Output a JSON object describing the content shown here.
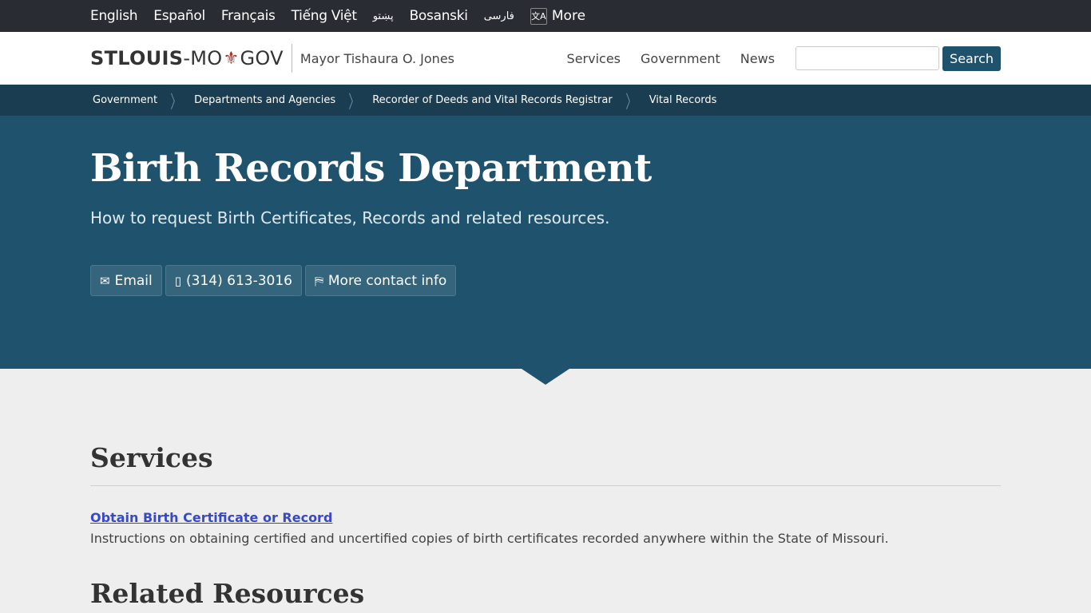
{
  "language_bar": {
    "languages": [
      "English",
      "Español",
      "Français",
      "Tiếng Việt",
      "پښتو",
      "Bosanski",
      "فارسی"
    ],
    "more_label": "More",
    "more_icon": "translate-icon"
  },
  "header": {
    "logo": {
      "part1": "STLOUIS",
      "part2": "-MO",
      "icon": "fleur-de-lis",
      "part3": "GOV"
    },
    "mayor": "Mayor Tishaura O. Jones",
    "nav": [
      "Services",
      "Government",
      "News"
    ],
    "search": {
      "value": "",
      "placeholder": "",
      "button_label": "Search"
    }
  },
  "breadcrumb": [
    "Government",
    "Departments and Agencies",
    "Recorder of Deeds and Vital Records Registrar",
    "Vital Records"
  ],
  "hero": {
    "title": "Birth Records Department",
    "lead": "How to request Birth Certificates, Records and related resources.",
    "contacts": [
      {
        "icon": "envelope-icon",
        "label": "Email"
      },
      {
        "icon": "mobile-phone-icon",
        "label": "(314) 613-3016"
      },
      {
        "icon": "map-icon",
        "label": "More contact info"
      }
    ]
  },
  "main": {
    "services_heading": "Services",
    "services": [
      {
        "title": "Obtain Birth Certificate or Record",
        "description": "Instructions on obtaining certified and uncertified copies of birth certificates recorded anywhere within the State of Missouri."
      }
    ],
    "related_heading": "Related Resources"
  },
  "colors": {
    "brand": "#1f536d",
    "breadcrumb_bg": "#1a3d52",
    "topbar_bg": "#292d33",
    "link": "#3849c7",
    "fleur": "#b0332a"
  }
}
